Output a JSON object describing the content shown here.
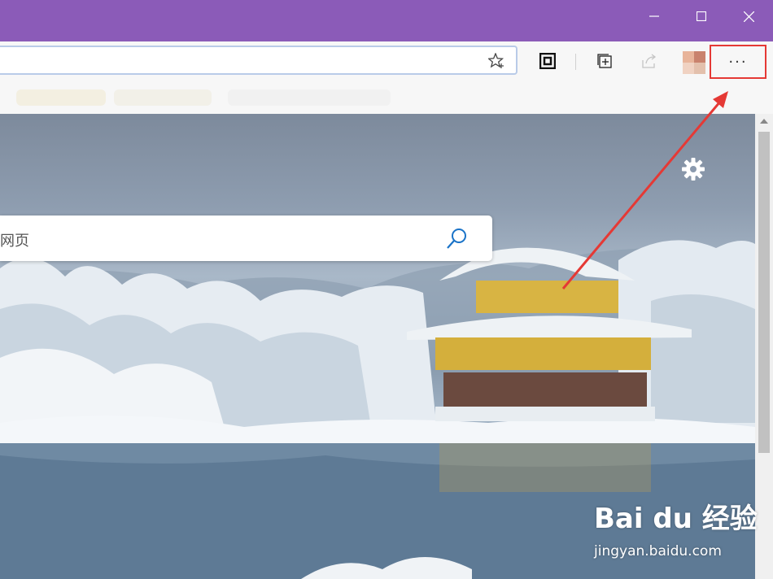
{
  "window": {
    "controls": [
      "minimize",
      "maximize",
      "close"
    ]
  },
  "toolbar": {
    "icons": [
      "favorite-star-icon",
      "reading-view-icon",
      "add-to-collections-icon",
      "share-icon",
      "profile-avatar",
      "more-icon"
    ],
    "more_label": "···"
  },
  "search": {
    "placeholder": "网页"
  },
  "watermark": {
    "logo": "Bai du 经验",
    "url": "jingyan.baidu.com"
  },
  "colors": {
    "title_bar": "#8b5bb8",
    "highlight_box": "#e53935",
    "annotation_arrow": "#e53935",
    "search_icon": "#1a73c8"
  }
}
